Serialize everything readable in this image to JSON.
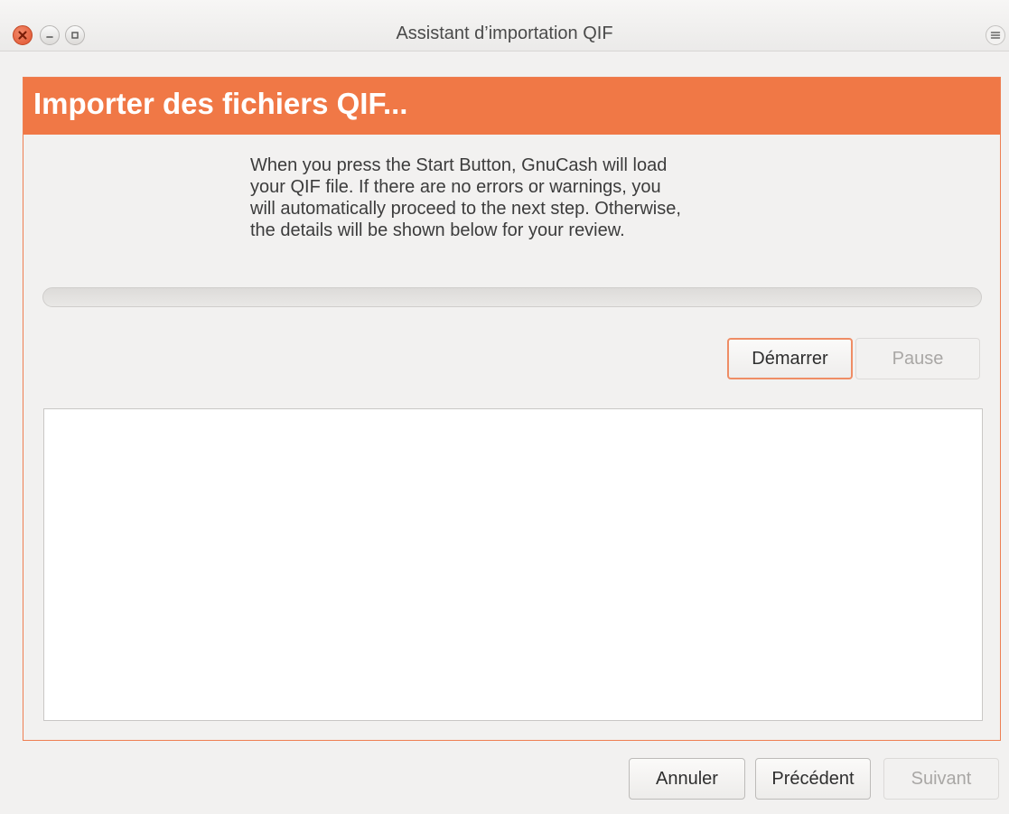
{
  "window": {
    "title": "Assistant d’importation QIF"
  },
  "page": {
    "banner_title": "Importer des fichiers QIF...",
    "instructions": "When you press the Start Button, GnuCash will load\nyour QIF file. If there are no errors or warnings, you\nwill automatically proceed to the next step. Otherwise,\nthe details will be shown below for your review.",
    "progress": 0,
    "start_label": "Démarrer",
    "pause_label": "Pause",
    "log_text": ""
  },
  "footer": {
    "cancel_label": "Annuler",
    "previous_label": "Précédent",
    "next_label": "Suivant"
  },
  "colors": {
    "accent": "#f07846",
    "accent_border": "#ee7f52",
    "window_bg": "#f2f1f0"
  }
}
